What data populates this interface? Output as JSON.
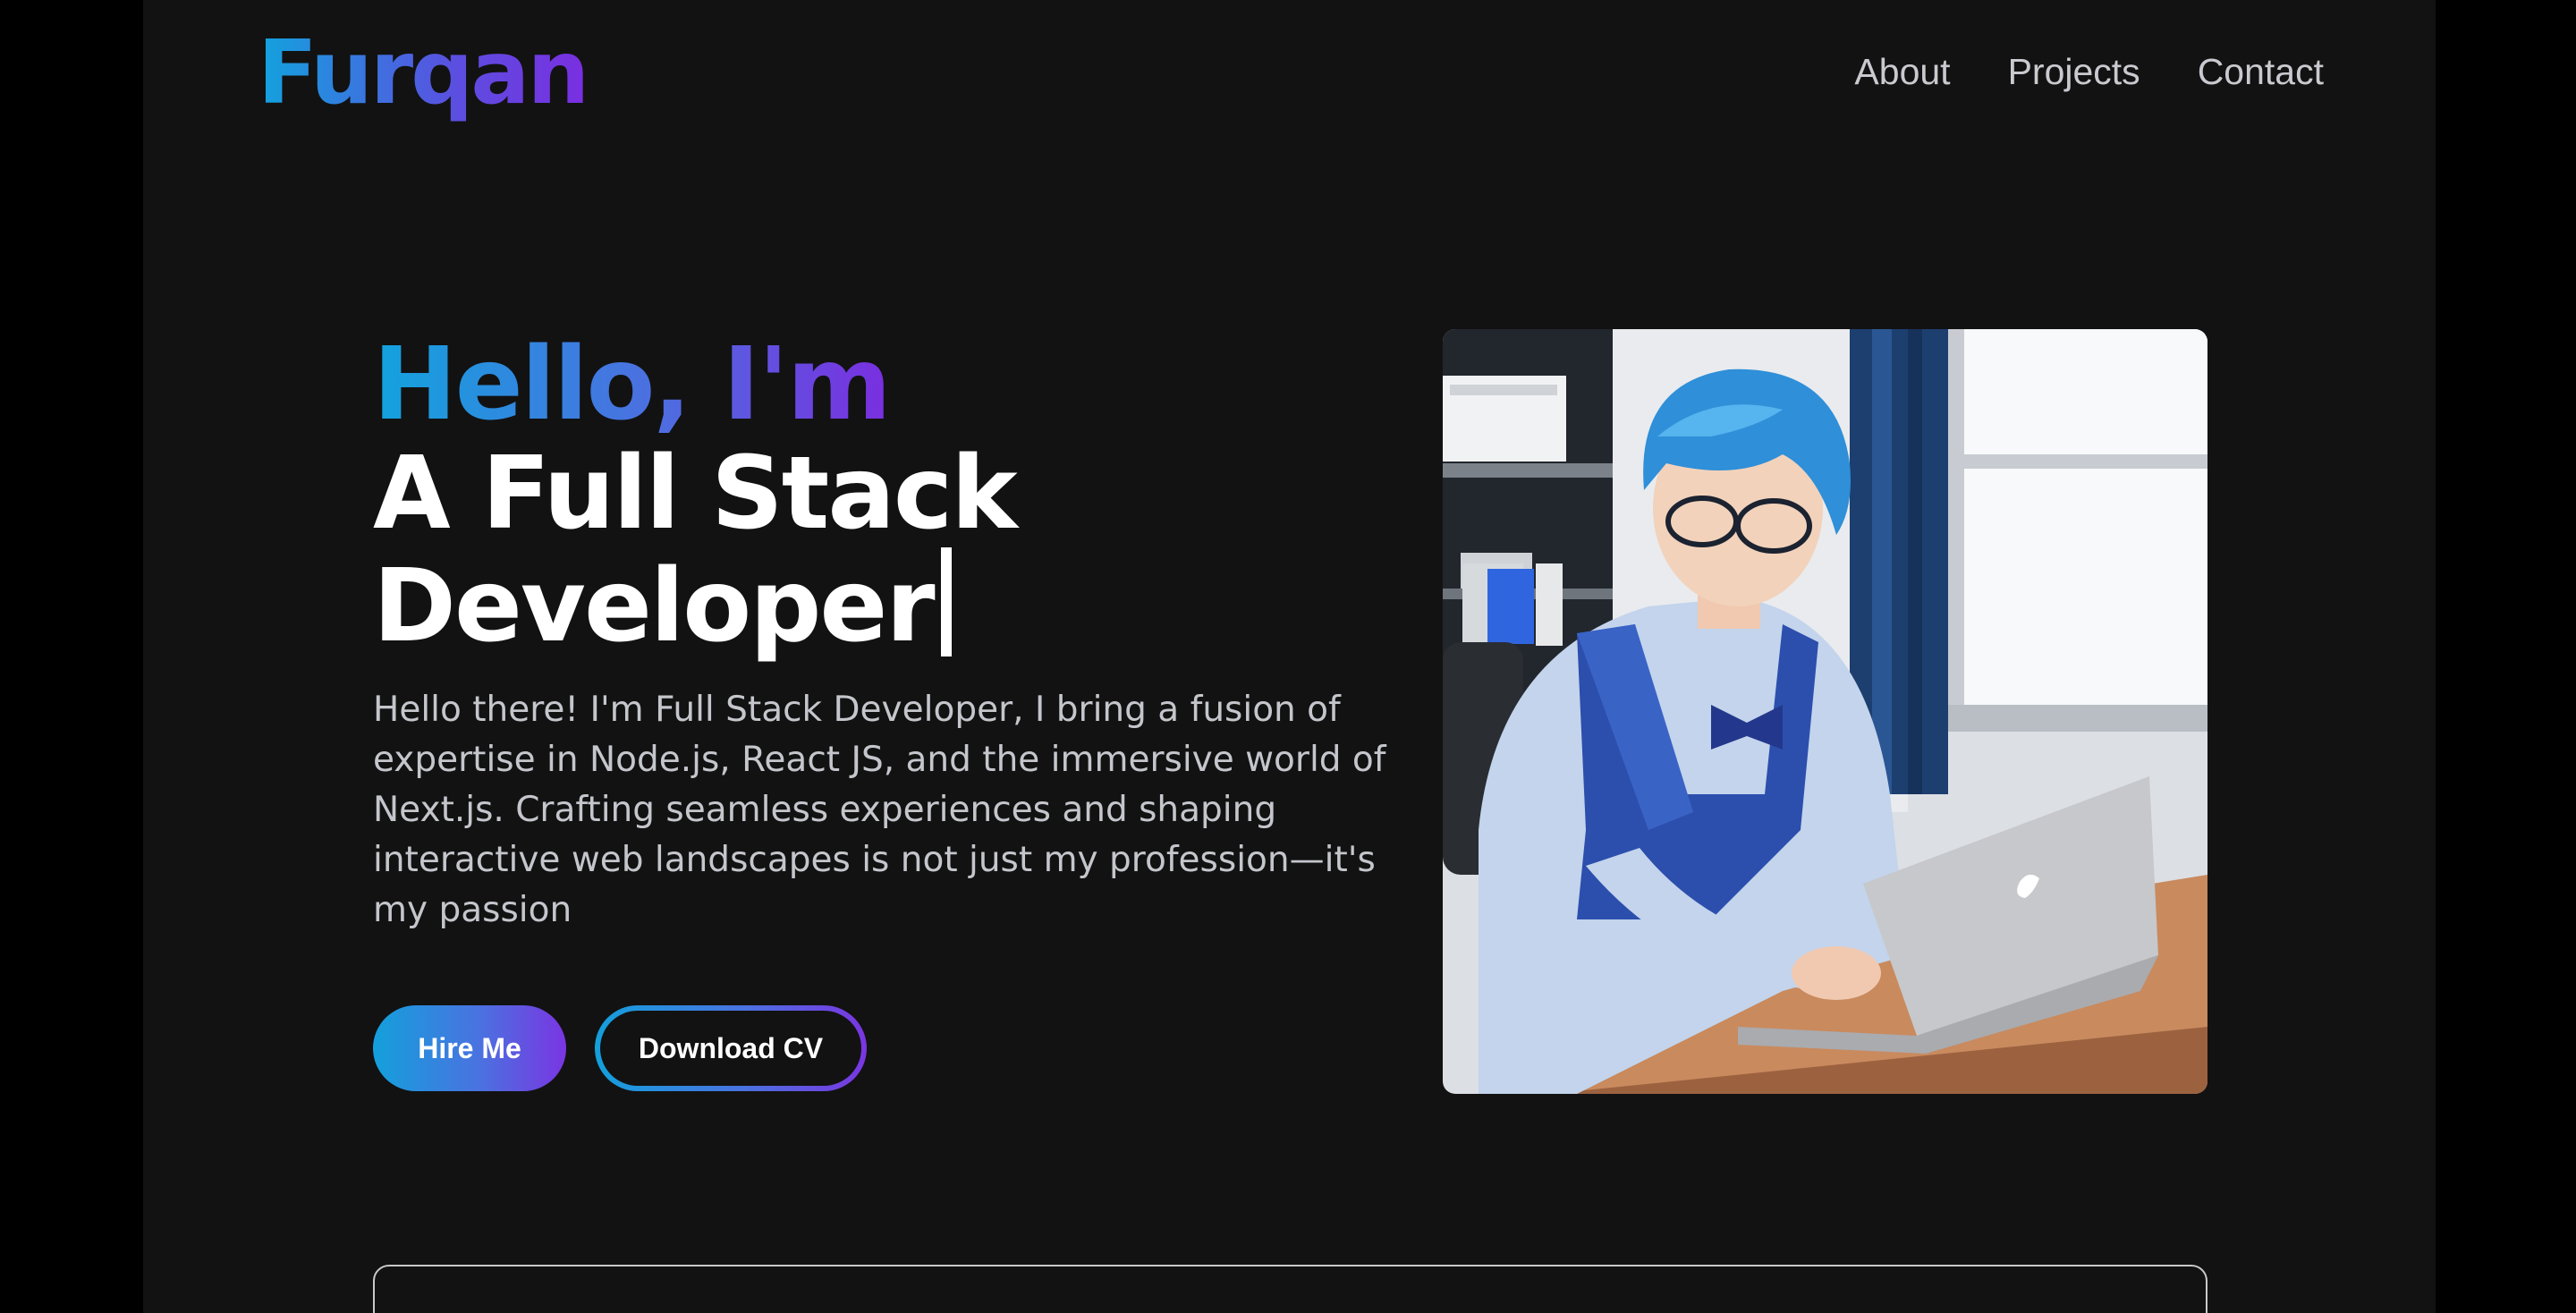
{
  "brand": {
    "logo": "Furqan"
  },
  "nav": {
    "items": [
      "About",
      "Projects",
      "Contact"
    ]
  },
  "hero": {
    "greeting": "Hello, I'm",
    "role": "A Full Stack Developer",
    "description": "Hello there! I'm Full Stack Developer, I bring a fusion of expertise in Node.js, React JS, and the immersive world of Next.js. Crafting seamless experiences and shaping interactive web landscapes is not just my profession—it's my passion",
    "buttons": {
      "primary": "Hire Me",
      "secondary": "Download CV"
    }
  },
  "colors": {
    "background": "#121212",
    "gradient_start": "#12a3de",
    "gradient_end": "#7a2ee0",
    "text_primary": "#ffffff",
    "text_secondary": "#c4c6cc"
  }
}
